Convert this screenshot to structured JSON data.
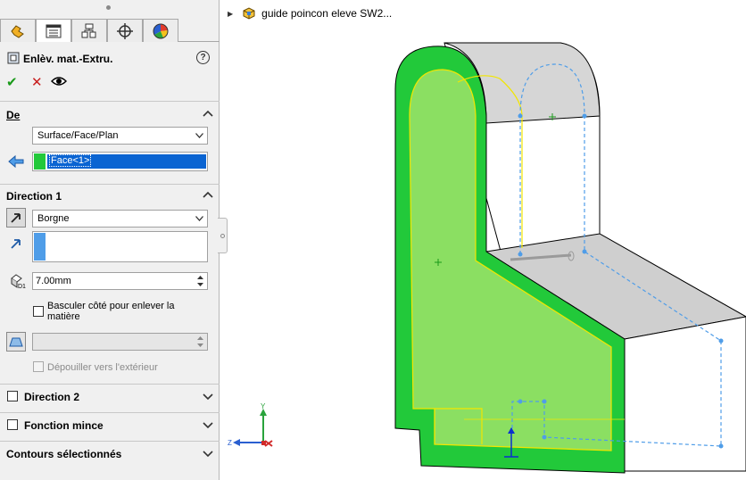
{
  "panel": {
    "title": "Enlèv. mat.-Extru.",
    "help": "?",
    "ok": "✔",
    "cancel": "✕",
    "tabs": [
      "feature-manager-icon",
      "property-manager-icon",
      "configuration-manager-icon",
      "dimxpert-icon",
      "display-manager-icon"
    ]
  },
  "from": {
    "title": "De",
    "start_condition": "Surface/Face/Plan",
    "selection": "Face<1>"
  },
  "direction1": {
    "title": "Direction 1",
    "end_condition": "Borgne",
    "depth": "7.00mm",
    "flip_side_label": "Basculer côté pour enlever la matière",
    "draft_label": "Dépouiller vers l'extérieur"
  },
  "direction2": {
    "title": "Direction 2"
  },
  "thin_feature": {
    "title": "Fonction mince"
  },
  "selected_contours": {
    "title": "Contours sélectionnés"
  },
  "viewport": {
    "tree_label": "guide poincon eleve SW2...",
    "triad": {
      "y": "Y",
      "z": "Z"
    }
  },
  "colors": {
    "face_green": "#22c93a",
    "face_light_green": "#8bdf62",
    "sketch_blue": "#4f9de8",
    "selection_blue": "#0a64d2",
    "edge_yellow": "#f2e600"
  }
}
